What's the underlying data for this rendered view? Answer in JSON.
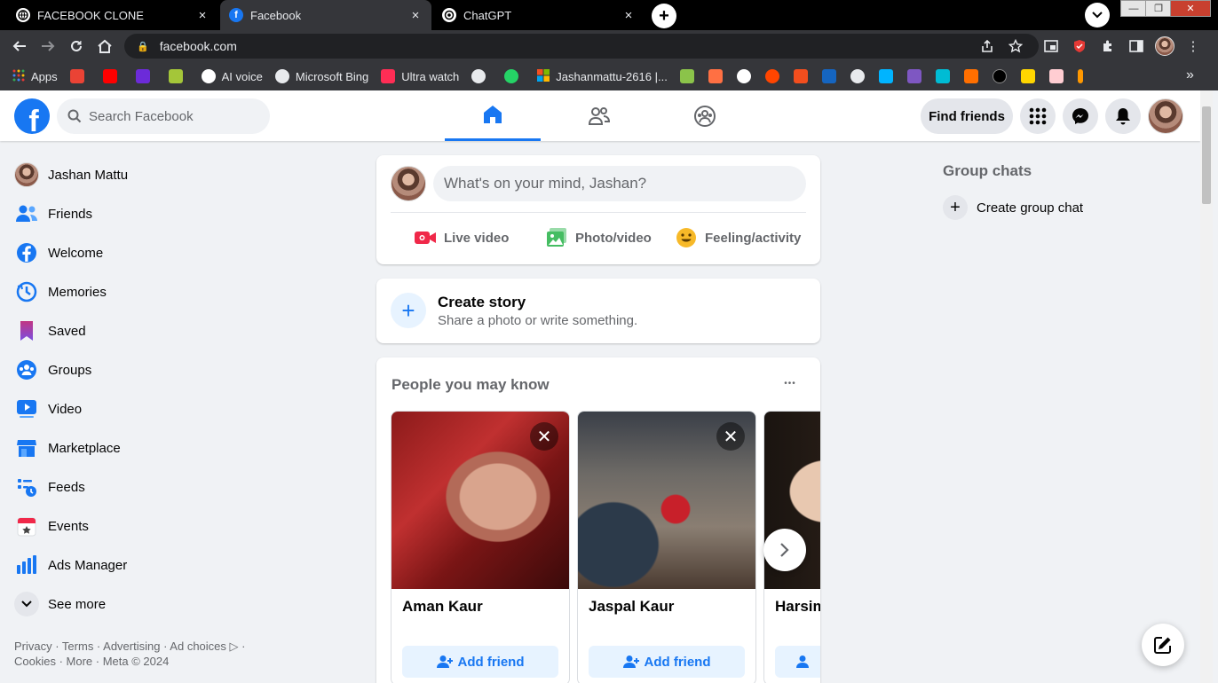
{
  "browser": {
    "tabs": [
      {
        "title": "FACEBOOK CLONE",
        "favicon": "globe-icon"
      },
      {
        "title": "Facebook",
        "favicon": "facebook-icon"
      },
      {
        "title": "ChatGPT",
        "favicon": "chatgpt-icon"
      }
    ],
    "close_glyph": "×",
    "new_tab_glyph": "+",
    "url": "facebook.com",
    "bookmarks": [
      {
        "label": "Apps",
        "color": "#e8eaed"
      },
      {
        "label": "",
        "color": "#ea4335"
      },
      {
        "label": "",
        "color": "#ff0000"
      },
      {
        "label": "",
        "color": "#6c2bd9"
      },
      {
        "label": "",
        "color": "#a4c639"
      },
      {
        "label": "AI voice",
        "color": "#ffffff"
      },
      {
        "label": "Microsoft Bing",
        "color": "#e8eaed"
      },
      {
        "label": "Ultra watch",
        "color": "#ff2d55"
      },
      {
        "label": "",
        "color": "#e8eaed"
      },
      {
        "label": "",
        "color": "#25d366"
      },
      {
        "label": "Jashanmattu-2616 |...",
        "color": "#f25022"
      }
    ],
    "bookmark_more_colors": [
      "#8bc34a",
      "#ff7043",
      "#ffffff",
      "#ff4500",
      "#f24e1e",
      "#1565c0",
      "#e8eaed",
      "#00b4ff",
      "#7e57c2",
      "#00bcd4",
      "#ff6f00",
      "#000000",
      "#ffd600",
      "#ffcdd2",
      "#ff9800"
    ],
    "overflow_glyph": "»"
  },
  "header": {
    "search_placeholder": "Search Facebook",
    "find_friends": "Find friends",
    "brand_color": "#1877f2"
  },
  "sidebar": {
    "items": [
      {
        "label": "Jashan Mattu",
        "icon": "profile-avatar"
      },
      {
        "label": "Friends",
        "icon": "friends-icon"
      },
      {
        "label": "Welcome",
        "icon": "facebook-icon"
      },
      {
        "label": "Memories",
        "icon": "clock-icon"
      },
      {
        "label": "Saved",
        "icon": "bookmark-icon"
      },
      {
        "label": "Groups",
        "icon": "groups-icon"
      },
      {
        "label": "Video",
        "icon": "video-icon"
      },
      {
        "label": "Marketplace",
        "icon": "store-icon"
      },
      {
        "label": "Feeds",
        "icon": "feeds-icon"
      },
      {
        "label": "Events",
        "icon": "calendar-icon"
      },
      {
        "label": "Ads Manager",
        "icon": "bar-chart-icon"
      },
      {
        "label": "See more",
        "icon": "chevron-down-icon"
      }
    ],
    "footer_line1": "Privacy · Terms · Advertising · Ad choices ▷ ·",
    "footer_line2": "Cookies · More · Meta © 2024"
  },
  "composer": {
    "placeholder": "What's on your mind, Jashan?",
    "actions": [
      "Live video",
      "Photo/video",
      "Feeling/activity"
    ]
  },
  "story": {
    "title": "Create story",
    "subtitle": "Share a photo or write something."
  },
  "pymk": {
    "title": "People you may know",
    "more_glyph": "•••",
    "people": [
      {
        "name": "Aman Kaur",
        "action": "Add friend"
      },
      {
        "name": "Jaspal Kaur",
        "action": "Add friend"
      },
      {
        "name": "Harsim",
        "action": ""
      }
    ],
    "close_glyph": "✕",
    "next_glyph": "›"
  },
  "right": {
    "group_chats": "Group chats",
    "create_group_chat": "Create group chat",
    "plus": "+"
  }
}
